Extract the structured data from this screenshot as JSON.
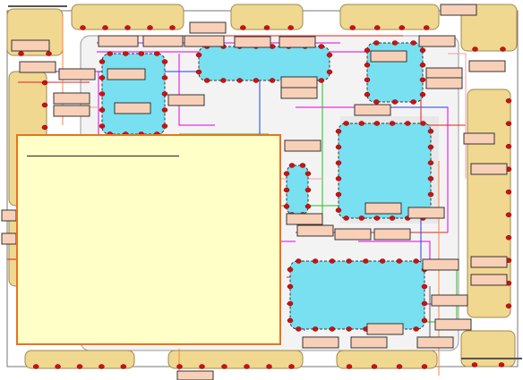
{
  "diagram": {
    "colors": {
      "pad": "#f0d890",
      "block": "#78e0f0",
      "die": "#f3f3f3",
      "label": "#f8d0b8",
      "pin": "#d01010",
      "panel_bg": "#ffffc8",
      "panel_border": "#e8741c",
      "wires": [
        "#e000e0",
        "#20c020",
        "#2040e0",
        "#e02020",
        "#ff8040",
        "#f0a0a0",
        "#606060"
      ]
    },
    "corner_labels": {
      "top_left": "",
      "bottom_right": ""
    },
    "info_panel": {
      "title": ""
    }
  }
}
